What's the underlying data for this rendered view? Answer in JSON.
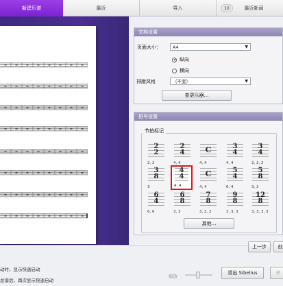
{
  "tabs": [
    {
      "label": "新建乐谱",
      "active": true
    },
    {
      "label": "最近",
      "active": false
    },
    {
      "label": "导入",
      "active": false
    },
    {
      "label": "最近新闻",
      "badge": "10",
      "active": false
    }
  ],
  "doc_settings": {
    "title": "文档设置",
    "page_size_label": "页面大小：",
    "page_size_value": "A4",
    "portrait_label": "纵向",
    "landscape_label": "横向",
    "orientation_selected": "纵向",
    "house_style_label": "排版风格",
    "house_style_value": "（不变）",
    "change_instruments_button": "变更乐器..."
  },
  "meter_settings": {
    "title": "拍号设置",
    "time_sig_group": "节拍标记",
    "time_signatures": [
      {
        "top": "2",
        "bottom": "2",
        "caption": "2, 2"
      },
      {
        "top": "2",
        "bottom": "4",
        "caption": "4, 4"
      },
      {
        "top": "C",
        "bottom": "",
        "caption": "4, 4"
      },
      {
        "top": "3",
        "bottom": "4",
        "caption": "4, 4"
      },
      {
        "top": "3",
        "bottom": "4",
        "caption": "2, 2, 2"
      },
      {
        "top": "3",
        "bottom": "8",
        "caption": "3"
      },
      {
        "top": "4",
        "bottom": "4",
        "caption": "4, 4",
        "selected": true
      },
      {
        "top": "C",
        "bottom": "",
        "caption": "4, 4"
      },
      {
        "top": "5",
        "bottom": "4",
        "caption": "6, 4"
      },
      {
        "top": "5",
        "bottom": "8",
        "caption": "3, 2"
      },
      {
        "top": "6",
        "bottom": "4",
        "caption": "6, 6"
      },
      {
        "top": "6",
        "bottom": "8",
        "caption": "3, 3"
      },
      {
        "top": "7",
        "bottom": "8",
        "caption": "3, 2, 2"
      },
      {
        "top": "9",
        "bottom": "8",
        "caption": "3, 3, 3"
      },
      {
        "top": "12",
        "bottom": "8",
        "caption": "3, 3, 3, 3"
      }
    ],
    "other_button": "其他..."
  },
  "nav": {
    "back_button": "上一步",
    "create_button": "创"
  },
  "footer": {
    "startup_text_1": "动时，显示快速启动",
    "startup_text_2": "总谱后，再次显示快速启动",
    "zoom_label": "缩放",
    "exit_button": "退出 Sibelius",
    "next_button": "关"
  },
  "colors": {
    "active_tab": "#8a2ee0",
    "selection": "#e2121c",
    "score_background": "#4b2f91"
  }
}
